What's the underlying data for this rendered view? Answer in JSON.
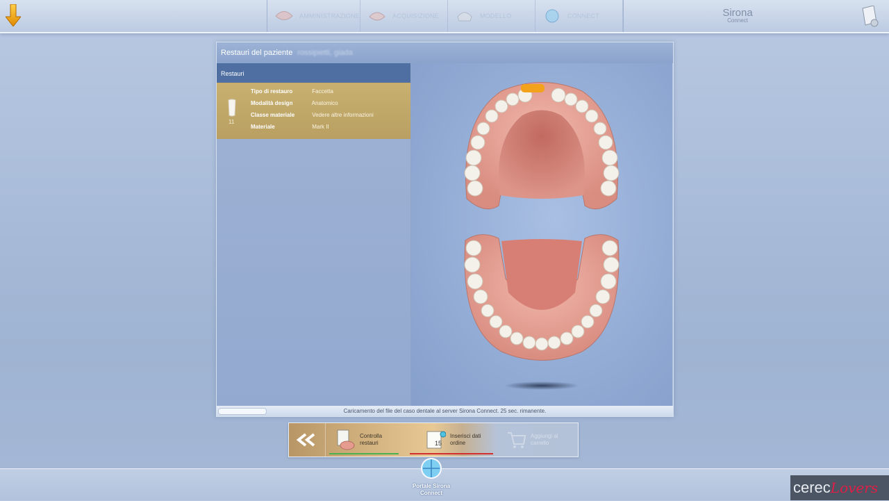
{
  "topbar": {
    "ghost_title": "",
    "steps": [
      {
        "label": "AMMINISTRAZIONE",
        "icon": "teeth-icon"
      },
      {
        "label": "ACQUISIZIONE",
        "icon": "scan-icon"
      },
      {
        "label": "MODELLO",
        "icon": "model-icon"
      },
      {
        "label": "CONNECT",
        "icon": "connect-icon"
      }
    ],
    "brand_name": "Sirona",
    "brand_sub": "Connect"
  },
  "window": {
    "title": "Restauri del paziente",
    "patient_name": "rossipietti, giada",
    "pane_title": "Restauri",
    "restoration": {
      "tooth_number": "11",
      "rows": [
        {
          "key": "Tipo di restauro",
          "value": "Faccetta"
        },
        {
          "key": "Modalità design",
          "value": "Anatomico"
        },
        {
          "key": "Classe materiale",
          "value": "Vedere altre informazioni"
        },
        {
          "key": "Materiale",
          "value": "Mark II"
        }
      ]
    },
    "status": "Caricamento del file del caso dentale al server Sirona Connect. 25 sec. rimanente."
  },
  "workflow": {
    "items": [
      {
        "label": "Controlla restauri",
        "line_color": "#4caf50"
      },
      {
        "label": "Inserisci dati ordine",
        "line_color": "#d32f2f"
      },
      {
        "label": "Aggiungi al carrello"
      }
    ]
  },
  "portal": {
    "label": "Portale Sirona Connect"
  },
  "logo": {
    "main": "cerec",
    "script": "Lovers"
  }
}
